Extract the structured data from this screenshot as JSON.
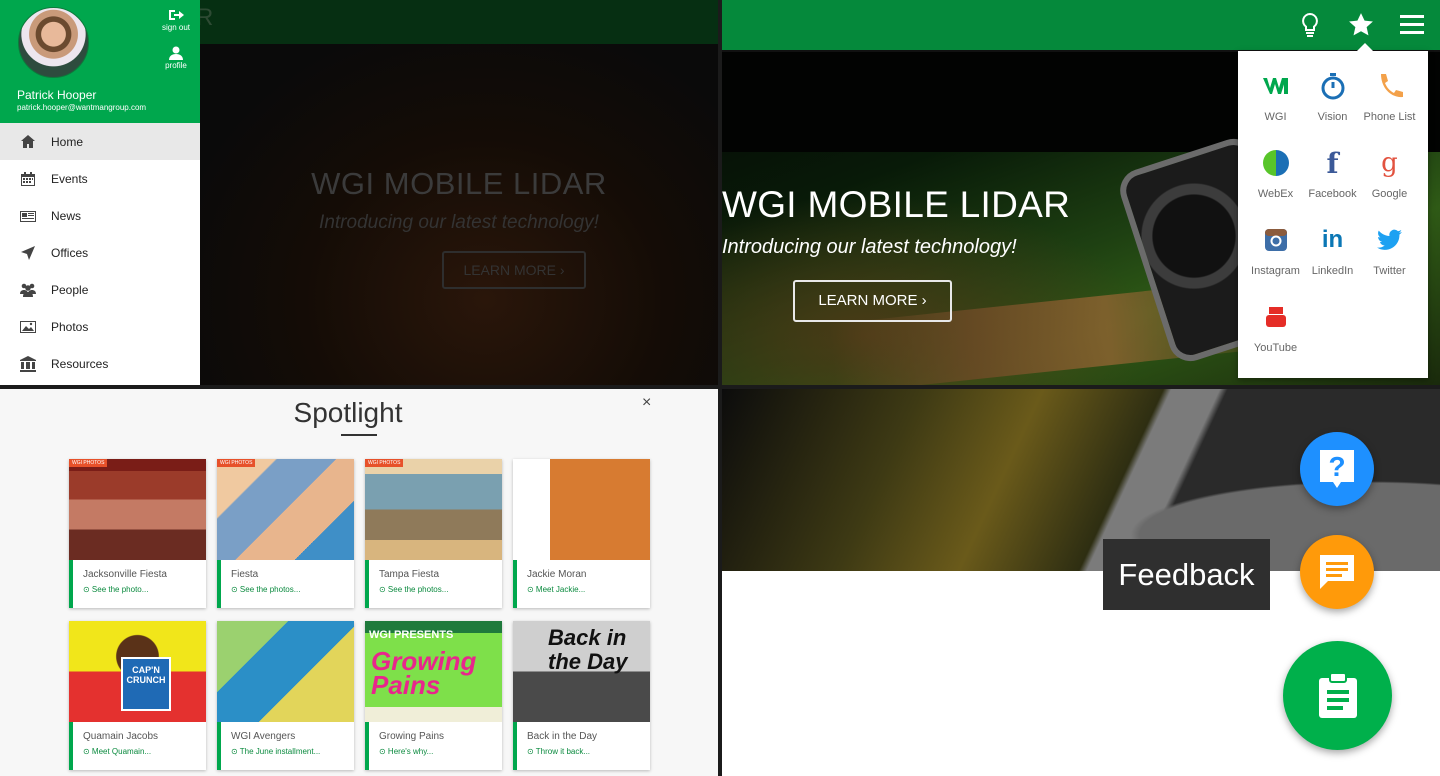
{
  "drawer": {
    "user_name": "Patrick Hooper",
    "user_email": "patrick.hooper@wantmangroup.com",
    "sign_out_label": "sign out",
    "profile_label": "profile",
    "menu": [
      {
        "label": "Home",
        "icon": "home-icon",
        "active": true
      },
      {
        "label": "Events",
        "icon": "calendar-icon"
      },
      {
        "label": "News",
        "icon": "newspaper-icon"
      },
      {
        "label": "Offices",
        "icon": "location-arrow-icon"
      },
      {
        "label": "People",
        "icon": "people-icon"
      },
      {
        "label": "Photos",
        "icon": "image-icon"
      },
      {
        "label": "Resources",
        "icon": "bank-icon"
      }
    ]
  },
  "hero": {
    "title": "WGI MOBILE LIDAR",
    "subtitle": "Introducing our latest technology!",
    "button": "LEARN MORE ›"
  },
  "header": {
    "bulb_icon": "lightbulb-icon",
    "star_icon": "star-icon",
    "menu_icon": "hamburger-menu-icon",
    "brand_color": "#05893b"
  },
  "quick_links": [
    {
      "label": "WGI",
      "icon": "wgi-logo-icon",
      "color": "#00a74d"
    },
    {
      "label": "Vision",
      "icon": "stopwatch-icon",
      "color": "#1b6fb5"
    },
    {
      "label": "Phone List",
      "icon": "phone-icon",
      "color": "#f3a14a"
    },
    {
      "label": "WebEx",
      "icon": "webex-icon",
      "color": "#58c52a"
    },
    {
      "label": "Facebook",
      "icon": "facebook-icon",
      "color": "#3b5998"
    },
    {
      "label": "Google",
      "icon": "google-icon",
      "color": "#e2523f"
    },
    {
      "label": "Instagram",
      "icon": "instagram-icon",
      "color": "#3d6ea8"
    },
    {
      "label": "LinkedIn",
      "icon": "linkedin-icon",
      "color": "#0b77b5"
    },
    {
      "label": "Twitter",
      "icon": "twitter-icon",
      "color": "#1da1f2"
    },
    {
      "label": "YouTube",
      "icon": "youtube-icon",
      "color": "#e52d27"
    }
  ],
  "spotlight": {
    "title": "Spotlight",
    "close": "×",
    "cards": [
      {
        "title": "Jacksonville Fiesta",
        "link": "⊙ See the photo..."
      },
      {
        "title": "Fiesta",
        "link": "⊙ See the photos..."
      },
      {
        "title": "Tampa Fiesta",
        "link": "⊙ See the photos..."
      },
      {
        "title": "Jackie Moran",
        "link": "⊙ Meet Jackie..."
      },
      {
        "title": "Quamain Jacobs",
        "link": "⊙ Meet Quamain..."
      },
      {
        "title": "WGI Avengers",
        "link": "⊙ The June installment..."
      },
      {
        "title": "Growing Pains",
        "link": "⊙ Here's why..."
      },
      {
        "title": "Back in the Day",
        "link": "⊙ Throw it back..."
      }
    ],
    "card_art": {
      "tag": "WGI PHOTOS",
      "capn_crunch": "CAP'N CRUNCH",
      "wgi_presents": "WGI PRESENTS",
      "growing_pains": "Growing Pains",
      "back_in_the_day": "Back in the Day"
    }
  },
  "fabs": {
    "tooltip": "Feedback",
    "help_icon": "help-bubble-icon",
    "feedback_icon": "feedback-message-icon",
    "main_icon": "clipboard-icon"
  }
}
